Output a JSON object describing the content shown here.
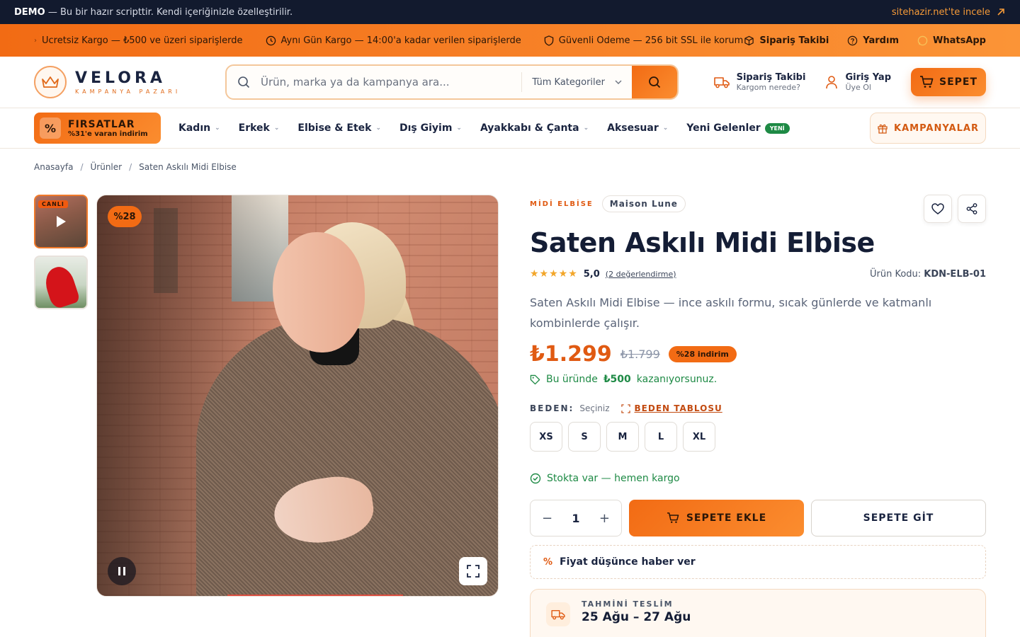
{
  "demo_bar": {
    "badge": "DEMO",
    "text": "— Bu bir hazır scripttir. Kendi içeriğinizle özelleştirilir.",
    "link": "sitehazir.net'te incele"
  },
  "promo_bar": {
    "items": [
      "Ücretsiz Kargo — ₺500 ve üzeri siparişlerde",
      "Aynı Gün Kargo — 14:00'a kadar verilen siparişlerde",
      "Güvenli Ödeme — 256 bit SSL ile koruma"
    ],
    "links": [
      "Sipariş Takibi",
      "Yardım",
      "WhatsApp"
    ]
  },
  "header": {
    "logo_name": "VELORA",
    "logo_sub": "KAMPANYA PAZARI",
    "search_placeholder": "Ürün, marka ya da kampanya ara...",
    "search_category": "Tüm Kategoriler",
    "order_title": "Sipariş Takibi",
    "order_sub": "Kargom nerede?",
    "login_title": "Giriş Yap",
    "login_sub": "Üye Ol",
    "cart_label": "SEPET"
  },
  "nav": {
    "deals_title": "FIRSATLAR",
    "deals_sub": "%31'e varan indirim",
    "items": [
      "Kadın",
      "Erkek",
      "Elbise & Etek",
      "Dış Giyim",
      "Ayakkabı & Çanta",
      "Aksesuar"
    ],
    "new_item": "Yeni Gelenler",
    "new_badge": "YENİ",
    "campaigns": "KAMPANYALAR"
  },
  "breadcrumb": [
    "Anasayfa",
    "Ürünler",
    "Saten Askılı Midi Elbise"
  ],
  "gallery": {
    "live_badge": "CANLI",
    "discount": "%28"
  },
  "product": {
    "category": "MİDİ ELBİSE",
    "brand": "Maison Lune",
    "title": "Saten Askılı Midi Elbise",
    "stars": "★★★★★",
    "rating": "5,0",
    "reviews": "(2 değerlendirme)",
    "sku_label": "Ürün Kodu:",
    "sku": "KDN-ELB-01",
    "description": "Saten Askılı Midi Elbise — ince askılı formu, sıcak günlerde ve katmanlı kombinlerde çalışır.",
    "price": "₺1.299",
    "old_price": "₺1.799",
    "discount_label": "%28 indirim",
    "earn_prefix": "Bu üründe",
    "earn_amount": "₺500",
    "earn_suffix": "kazanıyorsunuz.",
    "size_label": "BEDEN:",
    "size_choose": "Seçiniz",
    "size_chart": "BEDEN TABLOSU",
    "sizes": [
      "XS",
      "S",
      "M",
      "L",
      "XL"
    ],
    "stock": "Stokta var — hemen kargo",
    "qty": "1",
    "qty_minus": "−",
    "qty_plus": "+",
    "add_to_cart": "SEPETE EKLE",
    "go_to_cart": "SEPETE GİT",
    "price_alert": "Fiyat düşünce haber ver",
    "price_alert_icon": "%",
    "delivery_label": "TAHMİNİ TESLİM",
    "delivery_value": "25 Ağu – 27 Ağu"
  },
  "colors": {
    "accent": "#f26b14",
    "dark": "#121a2e",
    "success": "#1e8a45"
  }
}
